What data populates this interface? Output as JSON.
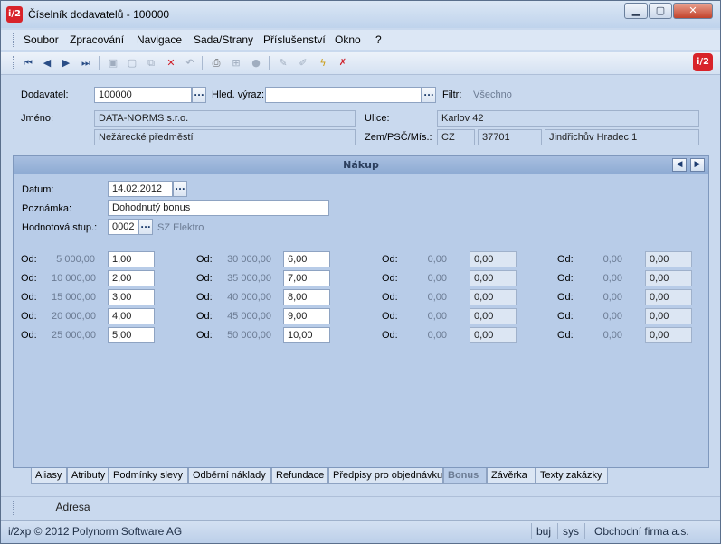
{
  "window": {
    "title": "Číselník dodavatelů - 100000",
    "app_icon": "i/2",
    "controls": {
      "minimize": "▁",
      "maximize": "▢",
      "close": "✕"
    }
  },
  "menu": [
    "Soubor",
    "Zpracování",
    "Navigace",
    "Sada/Strany",
    "Příslušenství",
    "Okno",
    "?"
  ],
  "toolbar": {
    "icons": [
      "first-record-icon",
      "previous-record-icon",
      "next-record-icon",
      "last-record-icon",
      "save-icon",
      "new-icon",
      "copy-icon",
      "delete-icon",
      "undo-icon",
      "print-icon",
      "structure-icon",
      "disabled-icon",
      "edit-icon",
      "edit-alt-icon",
      "filter-icon",
      "filter-clear-icon"
    ],
    "logo": "i/2"
  },
  "header": {
    "supplier_label": "Dodavatel:",
    "supplier_value": "100000",
    "search_label": "Hled. výraz:",
    "search_value": "",
    "filter_label": "Filtr:",
    "filter_value": "Všechno",
    "name_label": "Jméno:",
    "name_value": "DATA-NORMS s.r.o.",
    "name2_value": "Nežárecké předměstí",
    "street_label": "Ulice:",
    "street_value": "Karlov 42",
    "zip_label": "Zem/PSČ/Mís.:",
    "country_value": "CZ",
    "zip_value": "37701",
    "city_value": "Jindřichův Hradec 1"
  },
  "panel": {
    "title": "Nákup",
    "date_label": "Datum:",
    "date_value": "14.02.2012",
    "note_label": "Poznámka:",
    "note_value": "Dohodnutý bonus",
    "level_label": "Hodnotová stup.:",
    "level_value": "0002",
    "level_name": "SZ Elektro",
    "od_label": "Od:",
    "columns": [
      {
        "rows": [
          {
            "from": "5 000,00",
            "val": "1,00"
          },
          {
            "from": "10 000,00",
            "val": "2,00"
          },
          {
            "from": "15 000,00",
            "val": "3,00"
          },
          {
            "from": "20 000,00",
            "val": "4,00"
          },
          {
            "from": "25 000,00",
            "val": "5,00"
          }
        ]
      },
      {
        "rows": [
          {
            "from": "30 000,00",
            "val": "6,00"
          },
          {
            "from": "35 000,00",
            "val": "7,00"
          },
          {
            "from": "40 000,00",
            "val": "8,00"
          },
          {
            "from": "45 000,00",
            "val": "9,00"
          },
          {
            "from": "50 000,00",
            "val": "10,00"
          }
        ]
      },
      {
        "rows": [
          {
            "from": "0,00",
            "val": "0,00"
          },
          {
            "from": "0,00",
            "val": "0,00"
          },
          {
            "from": "0,00",
            "val": "0,00"
          },
          {
            "from": "0,00",
            "val": "0,00"
          },
          {
            "from": "0,00",
            "val": "0,00"
          }
        ]
      },
      {
        "rows": [
          {
            "from": "0,00",
            "val": "0,00"
          },
          {
            "from": "0,00",
            "val": "0,00"
          },
          {
            "from": "0,00",
            "val": "0,00"
          },
          {
            "from": "0,00",
            "val": "0,00"
          },
          {
            "from": "0,00",
            "val": "0,00"
          }
        ]
      }
    ]
  },
  "tabs": [
    "Aliasy",
    "Atributy",
    "Podmínky slevy",
    "Odběrní náklady",
    "Refundace",
    "Předpisy pro objednávku",
    "Bonus",
    "Závěrka",
    "Texty zakázky"
  ],
  "active_tab": "Bonus",
  "address_button": "Adresa",
  "status": {
    "copyright": "i/2xp © 2012 Polynorm Software AG",
    "user": "buj",
    "system": "sys",
    "company": "Obchodní firma a.s."
  }
}
